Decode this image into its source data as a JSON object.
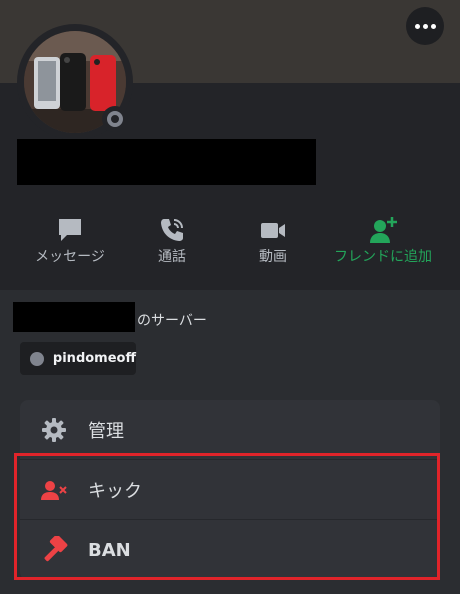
{
  "header": {
    "more_button": "more-icon"
  },
  "actions": [
    {
      "label": "メッセージ",
      "icon": "message-icon"
    },
    {
      "label": "通話",
      "icon": "phone-icon"
    },
    {
      "label": "動画",
      "icon": "video-icon"
    },
    {
      "label": "フレンドに追加",
      "icon": "add-friend-icon"
    }
  ],
  "server": {
    "suffix": "のサーバー",
    "chip_label": "pindomeoff"
  },
  "menu": {
    "items": [
      {
        "label": "管理",
        "icon": "gear-icon"
      },
      {
        "label": "キック",
        "icon": "kick-user-icon"
      },
      {
        "label": "BAN",
        "icon": "ban-hammer-icon"
      }
    ]
  },
  "colors": {
    "accent_green": "#23a55a",
    "danger_red": "#ed4245",
    "highlight_border": "#e0242a",
    "status_offline": "#80848e"
  }
}
